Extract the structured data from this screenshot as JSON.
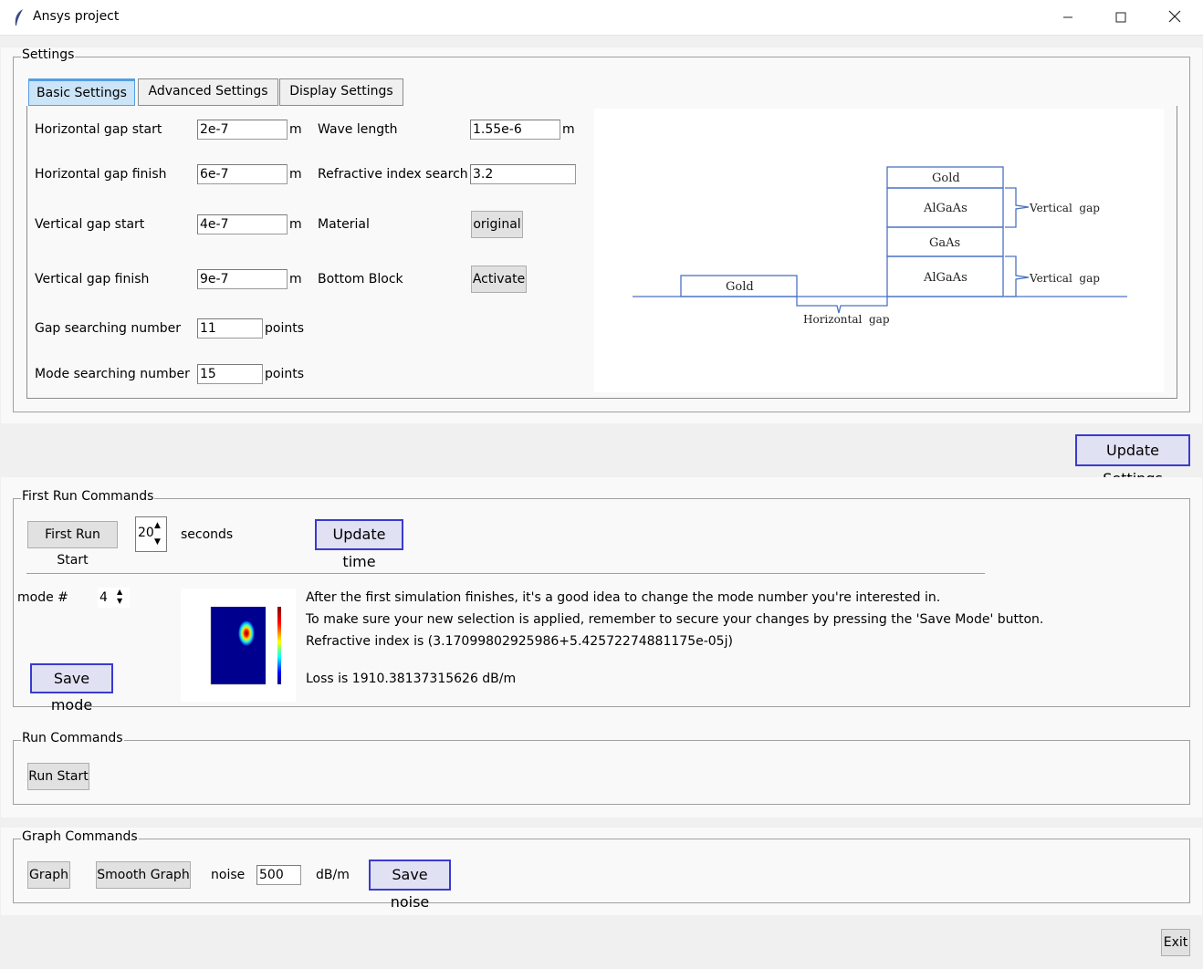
{
  "window": {
    "title": "Ansys project",
    "minimize_icon": "minimize-icon",
    "maximize_icon": "maximize-icon",
    "close_icon": "close-icon"
  },
  "settings": {
    "group_label": "Settings",
    "tabs": [
      {
        "label": "Basic Settings",
        "active": true
      },
      {
        "label": "Advanced Settings",
        "active": false
      },
      {
        "label": "Display Settings",
        "active": false
      }
    ],
    "left_fields": [
      {
        "label": "Horizontal gap start",
        "value": "2e-7",
        "unit": "m"
      },
      {
        "label": "Horizontal gap finish",
        "value": "6e-7",
        "unit": "m"
      },
      {
        "label": "Vertical gap start",
        "value": "4e-7",
        "unit": "m"
      },
      {
        "label": "Vertical gap finish",
        "value": "9e-7",
        "unit": "m"
      },
      {
        "label": "Gap searching number",
        "value": "11",
        "unit": "points"
      },
      {
        "label": "Mode searching number",
        "value": "15",
        "unit": "points"
      }
    ],
    "right_fields": {
      "wave_length": {
        "label": "Wave length",
        "value": "1.55e-6",
        "unit": "m"
      },
      "refractive_index_search": {
        "label": "Refractive index search",
        "value": "3.2"
      },
      "material": {
        "label": "Material",
        "button": "original"
      },
      "bottom_block": {
        "label": "Bottom Block",
        "button": "Activate"
      }
    },
    "diagram": {
      "gold_top": "Gold",
      "algaas_top": "AlGaAs",
      "gaas": "GaAs",
      "algaas_bottom": "AlGaAs",
      "gold_left": "Gold",
      "vertical_gap_top": "Vertical  gap",
      "vertical_gap_bottom": "Vertical  gap",
      "horizontal_gap": "Horizontal  gap"
    }
  },
  "update_settings_button": "Update Settings",
  "first_run": {
    "group_label": "First Run Commands",
    "start_button": "First Run Start",
    "seconds_value": "20",
    "seconds_label": "seconds",
    "update_time_button": "Update time",
    "mode_label": "mode #",
    "mode_value": "4",
    "save_mode_button": "Save mode",
    "info_line1": "After the first simulation finishes, it's a good idea to change the mode number you're interested in.",
    "info_line2": "To make sure your new selection is applied, remember to secure your changes by pressing the 'Save Mode' button.",
    "refractive_index_text": "Refractive index is (3.17099802925986+5.42572274881175e-05j)",
    "loss_text": "Loss is 1910.38137315626 dB/m"
  },
  "run": {
    "group_label": "Run Commands",
    "start_button": "Run Start"
  },
  "graph": {
    "group_label": "Graph Commands",
    "graph_button": "Graph",
    "smooth_button": "Smooth Graph",
    "noise_label": "noise",
    "noise_value": "500",
    "noise_unit": "dB/m",
    "save_noise_button": "Save noise"
  },
  "exit_button": "Exit",
  "colors": {
    "accent_border": "#3a3acf",
    "tab_active_bg": "#cce4f7",
    "diagram_line": "#4a72c4"
  }
}
